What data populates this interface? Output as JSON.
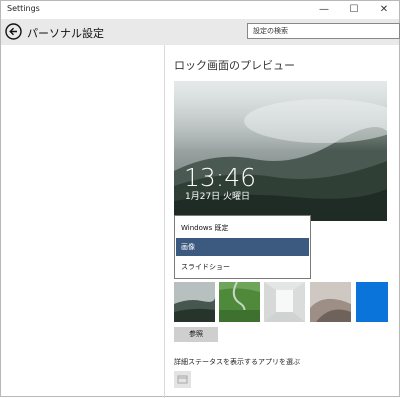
{
  "window": {
    "title": "Settings",
    "minimize_glyph": "—",
    "maximize_glyph": "☐",
    "close_glyph": "✕"
  },
  "header": {
    "title": "パーソナル設定",
    "back_icon": "back-arrow-icon",
    "search_placeholder": "設定の検索"
  },
  "lockscreen": {
    "preview_title": "ロック画面のプレビュー",
    "time": "13:46",
    "date": "1月27日 火曜日"
  },
  "background_dropdown": {
    "options": [
      "Windows 既定",
      "画像",
      "スライドショー"
    ],
    "selected_index": 1
  },
  "thumbnails": [
    {
      "name": "misty-landscape-thumbnail"
    },
    {
      "name": "green-river-thumbnail"
    },
    {
      "name": "white-room-thumbnail"
    },
    {
      "name": "sand-dunes-thumbnail"
    },
    {
      "name": "blue-windows-thumbnail"
    }
  ],
  "browse_label": "参照",
  "apps_label": "詳細ステータスを表示するアプリを選ぶ",
  "colors": {
    "header_bg": "#e9e9e9",
    "selected_bg": "#3c5a80",
    "button_bg": "#cfcfcf"
  }
}
